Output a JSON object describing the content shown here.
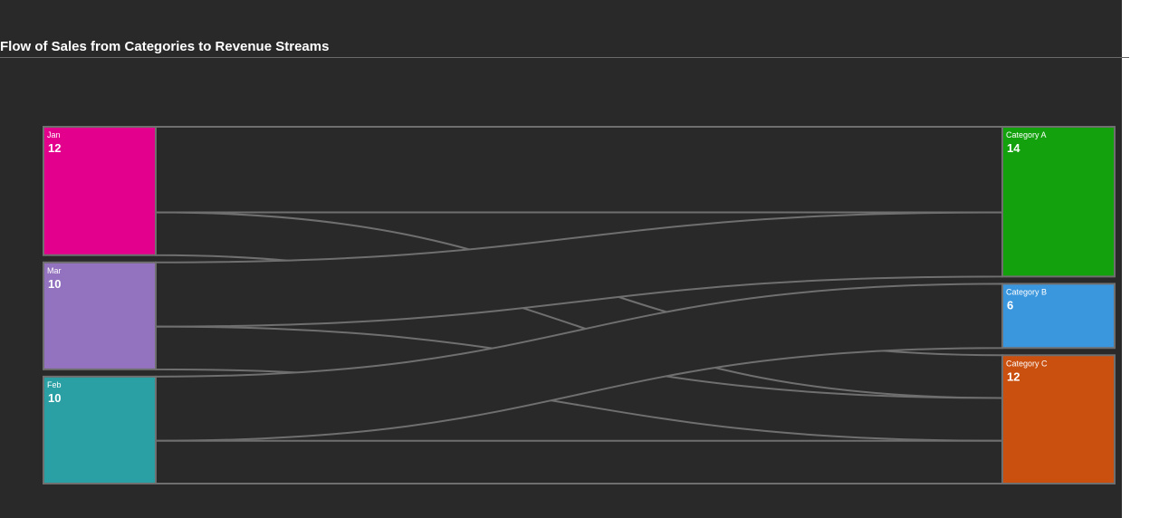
{
  "chart_data": {
    "type": "sankey",
    "title": "Flow of Sales from Categories to Revenue Streams",
    "sources": [
      {
        "name": "Jan",
        "value": 12,
        "color": "#e3008c"
      },
      {
        "name": "Mar",
        "value": 10,
        "color": "#9373bf"
      },
      {
        "name": "Feb",
        "value": 10,
        "color": "#2ba0a4"
      }
    ],
    "targets": [
      {
        "name": "Category A",
        "value": 14,
        "color": "#13a10e"
      },
      {
        "name": "Category B",
        "value": 6,
        "color": "#3a96dd"
      },
      {
        "name": "Category C",
        "value": 12,
        "color": "#ca5010"
      }
    ],
    "links": [
      {
        "source": "Jan",
        "target": "Category A",
        "value": 8
      },
      {
        "source": "Jan",
        "target": "Category B",
        "value": 0
      },
      {
        "source": "Jan",
        "target": "Category C",
        "value": 4
      },
      {
        "source": "Mar",
        "target": "Category A",
        "value": 6
      },
      {
        "source": "Mar",
        "target": "Category B",
        "value": 0
      },
      {
        "source": "Mar",
        "target": "Category C",
        "value": 4
      },
      {
        "source": "Feb",
        "target": "Category A",
        "value": 0
      },
      {
        "source": "Feb",
        "target": "Category B",
        "value": 6
      },
      {
        "source": "Feb",
        "target": "Category C",
        "value": 4
      }
    ],
    "link_color": "#292929",
    "link_stroke": "#6f6f6f",
    "node_border": "#6f6f6f"
  }
}
